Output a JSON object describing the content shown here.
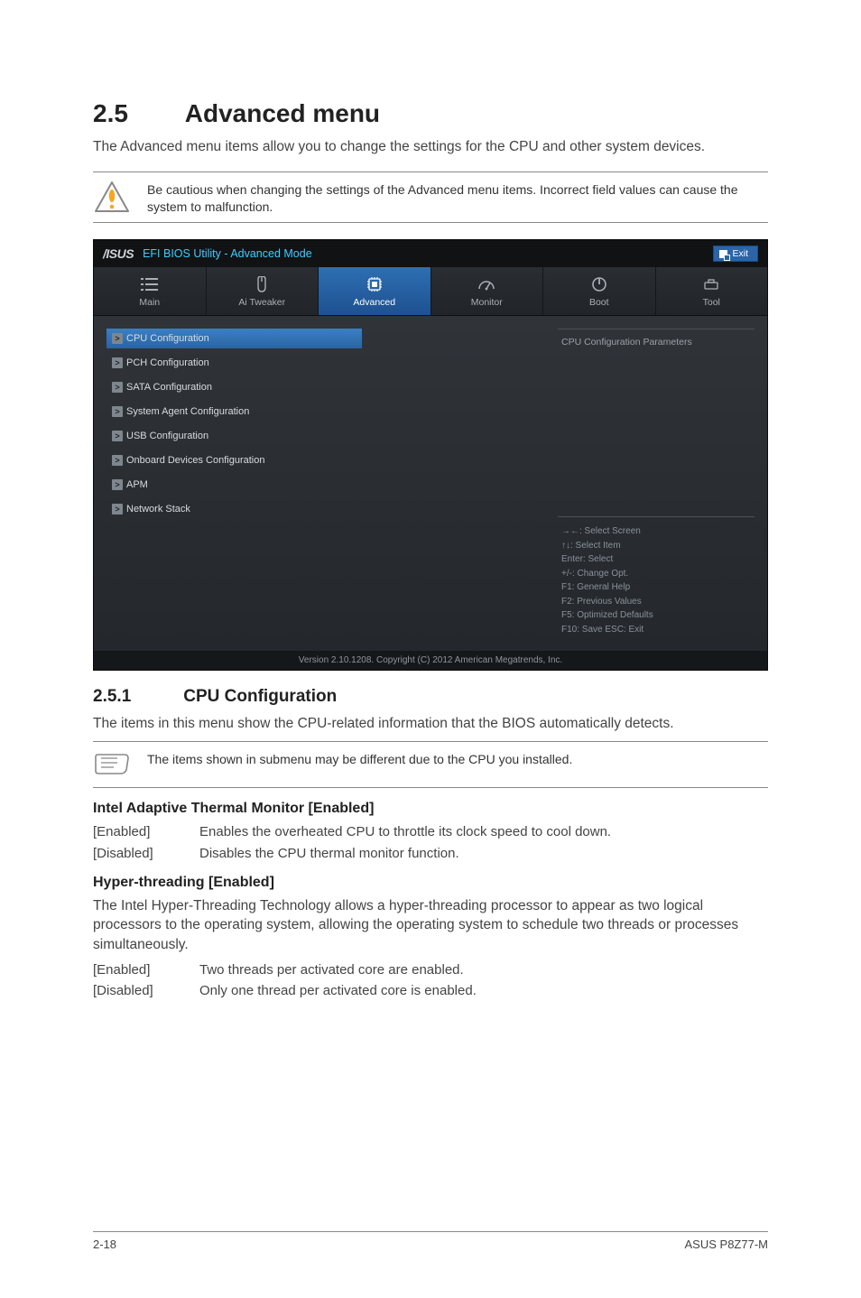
{
  "heading": {
    "num": "2.5",
    "title": "Advanced menu"
  },
  "intro": "The Advanced menu items allow you to change the settings for the CPU and other system devices.",
  "warning": "Be cautious when changing the settings of the Advanced menu items. Incorrect field values can cause the system to malfunction.",
  "bios": {
    "brand": "/ISUS",
    "title": "EFI BIOS Utility - Advanced Mode",
    "exit": "Exit",
    "tabs": [
      "Main",
      "Ai Tweaker",
      "Advanced",
      "Monitor",
      "Boot",
      "Tool"
    ],
    "active_tab_index": 2,
    "menu": [
      "CPU Configuration",
      "PCH Configuration",
      "SATA Configuration",
      "System Agent Configuration",
      "USB Configuration",
      "Onboard Devices Configuration",
      "APM",
      "Network Stack"
    ],
    "selected_index": 0,
    "info_title": "CPU Configuration Parameters",
    "help": [
      "→←:  Select Screen",
      "↑↓:  Select Item",
      "Enter:  Select",
      "+/-:  Change Opt.",
      "F1:  General Help",
      "F2:  Previous Values",
      "F5:  Optimized Defaults",
      "F10:  Save   ESC:  Exit"
    ],
    "footer": "Version  2.10.1208.  Copyright  (C)  2012  American  Megatrends,  Inc."
  },
  "sub": {
    "num": "2.5.1",
    "title": "CPU Configuration"
  },
  "subintro": "The items in this menu show the CPU-related information that the BIOS automatically detects.",
  "note": "The items shown in submenu may be different due to the CPU you installed.",
  "s1": {
    "title": "Intel Adaptive Thermal Monitor [Enabled]",
    "opts": [
      {
        "k": "[Enabled]",
        "v": "Enables the overheated CPU to throttle its clock speed to cool down."
      },
      {
        "k": "[Disabled]",
        "v": "Disables the CPU thermal monitor function."
      }
    ]
  },
  "s2": {
    "title": "Hyper-threading [Enabled]",
    "para": "The Intel Hyper-Threading Technology allows a hyper-threading processor to appear as two logical processors to the operating system, allowing the operating system to schedule two threads or processes simultaneously.",
    "opts": [
      {
        "k": "[Enabled]",
        "v": "Two threads per activated core are enabled."
      },
      {
        "k": "[Disabled]",
        "v": "Only one thread per activated core is enabled."
      }
    ]
  },
  "footer": {
    "left": "2-18",
    "right": "ASUS P8Z77-M"
  }
}
